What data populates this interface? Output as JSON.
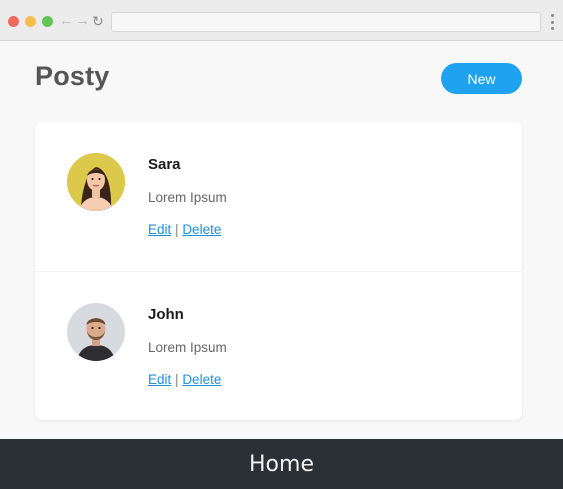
{
  "app": {
    "title": "Posty",
    "new_label": "New"
  },
  "posts": [
    {
      "name": "Sara",
      "body": "Lorem Ipsum",
      "edit_label": "Edit",
      "separator": "|",
      "delete_label": "Delete"
    },
    {
      "name": "John",
      "body": "Lorem Ipsum",
      "edit_label": "Edit",
      "separator": "|",
      "delete_label": "Delete"
    }
  ],
  "footer": {
    "label": "Home"
  },
  "icons": {
    "back": "arrow-left-icon",
    "forward": "arrow-right-icon",
    "reload": "reload-icon",
    "menu": "kebab-menu-icon"
  },
  "colors": {
    "accent": "#1fa3f1",
    "link": "#1f8fd9",
    "title": "#555555",
    "footer_bg": "#2b3034"
  }
}
